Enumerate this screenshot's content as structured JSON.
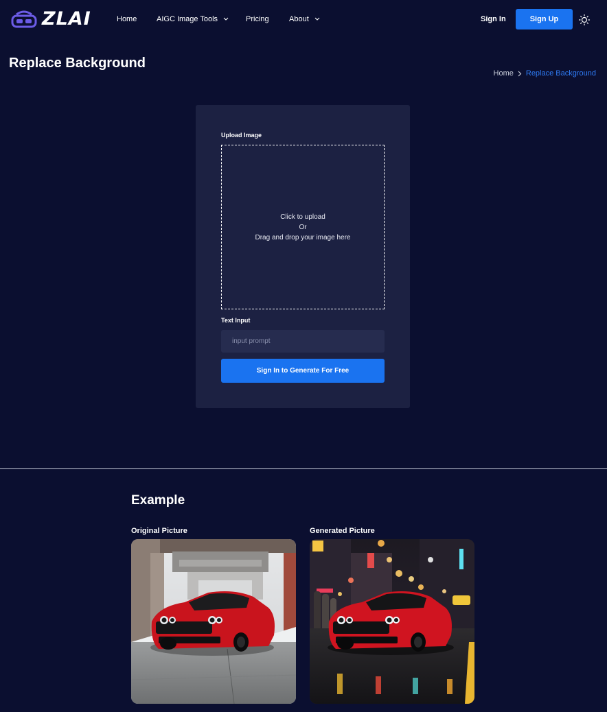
{
  "brand": {
    "name": "ZLAI"
  },
  "nav": {
    "items": [
      {
        "label": "Home",
        "dropdown": false
      },
      {
        "label": "AIGC Image Tools",
        "dropdown": true
      },
      {
        "label": "Pricing",
        "dropdown": false
      },
      {
        "label": "About",
        "dropdown": true
      }
    ],
    "sign_in": "Sign In",
    "sign_up": "Sign Up",
    "theme_icon": "sun-icon"
  },
  "page": {
    "title": "Replace Background",
    "breadcrumb": {
      "home": "Home",
      "current": "Replace Background"
    }
  },
  "form": {
    "upload_label": "Upload Image",
    "upload_line1": "Click to upload",
    "upload_line2": "Or",
    "upload_line3": "Drag and drop your image here",
    "text_label": "Text Input",
    "prompt_value": "",
    "prompt_placeholder": "input prompt",
    "generate_button": "Sign In to Generate For Free"
  },
  "example": {
    "title": "Example",
    "original_label": "Original Picture",
    "generated_label": "Generated Picture"
  },
  "colors": {
    "background": "#0b0f30",
    "card": "#1c2142",
    "input": "#262c4f",
    "accent": "#1a73f0",
    "breadcrumb_active": "#2f7cf6"
  }
}
